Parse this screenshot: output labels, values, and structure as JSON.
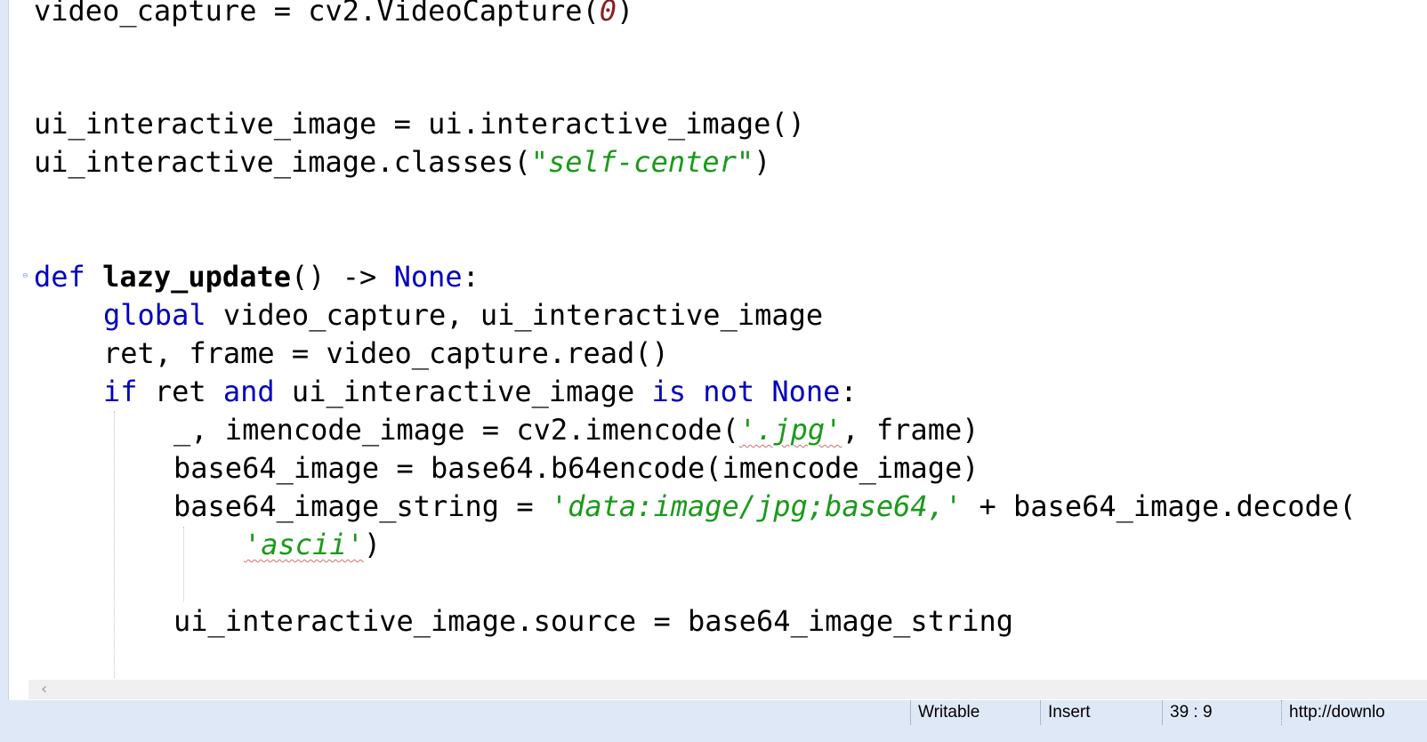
{
  "editor": {
    "lines": {
      "l1": {
        "a": "video_capture = cv2.VideoCapture(",
        "num": "0",
        "b": ")"
      },
      "l2": {
        "a": "ui_interactive_image = ui.interactive_image()"
      },
      "l3": {
        "a": "ui_interactive_image.classes(",
        "str": "\"self-center\"",
        "b": ")"
      },
      "l4": {
        "kw": "def",
        "fn": "lazy_update",
        "a": "() -> ",
        "kw2": "None",
        "b": ":"
      },
      "l5": {
        "kw": "global",
        "a": " video_capture, ui_interactive_image"
      },
      "l6": {
        "a": "ret, frame = video_capture.read()"
      },
      "l7": {
        "kw": "if",
        "a": " ret ",
        "kw2": "and",
        "b": " ui_interactive_image ",
        "kw3": "is not None",
        "c": ":"
      },
      "l8": {
        "a": "_, imencode_image = cv2.imencode(",
        "str": "'.jpg'",
        "b": ", frame)"
      },
      "l9": {
        "a": "base64_image = base64.b64encode(imencode_image)"
      },
      "l10": {
        "a": "base64_image_string = ",
        "str": "'data:image/jpg;base64,'",
        "b": " + base64_image.decode("
      },
      "l11": {
        "str": "'ascii'",
        "b": ")"
      },
      "l12": {
        "a": "ui_interactive_image.source = base64_image_string"
      }
    }
  },
  "statusbar": {
    "mode": "Writable",
    "insert": "Insert",
    "position": "39 : 9",
    "url": "http://downlo"
  },
  "icons": {
    "scroll_left": "chevron-left-icon",
    "fold": "fold-marker-icon"
  },
  "colors": {
    "keyword": "#0000c0",
    "string": "#1a9a1a",
    "number": "#8a1f1f",
    "statusbar_bg": "#dfe8f6"
  }
}
